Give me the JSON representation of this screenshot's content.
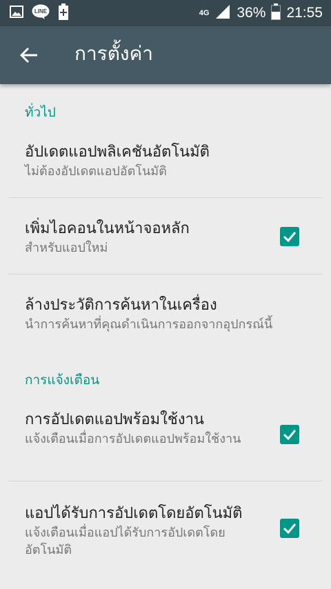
{
  "status_bar": {
    "icons_left": [
      "image-icon",
      "line-app-icon",
      "battery-saver-plus-icon"
    ],
    "network": "4G",
    "battery": "36%",
    "time": "21:55"
  },
  "app_bar": {
    "title": "การตั้งค่า",
    "back_icon": "arrow-back-icon"
  },
  "sections": {
    "general": {
      "header": "ทั่วไป",
      "items": [
        {
          "title": "อัปเดตแอปพลิเคชันอัตโนมัติ",
          "summary": "ไม่ต้องอัปเดตแอปอัตโนมัติ"
        },
        {
          "title": "เพิ่มไอคอนในหน้าจอหลัก",
          "summary": "สำหรับแอปใหม่",
          "checked": true
        },
        {
          "title": "ล้างประวัติการค้นหาในเครื่อง",
          "summary": "นำการค้นหาที่คุณดำเนินการออกจากอุปกรณ์นี้"
        }
      ]
    },
    "notifications": {
      "header": "การแจ้งเตือน",
      "items": [
        {
          "title": "การอัปเดตแอปพร้อมใช้งาน",
          "summary": "แจ้งเตือนเมื่อการอัปเดตแอปพร้อมใช้งาน",
          "checked": true
        },
        {
          "title": "แอปได้รับการอัปเดตโดยอัตโนมัติ",
          "summary": "แจ้งเตือนเมื่อแอปได้รับการอัปเดตโดยอัตโนมัติ",
          "checked": true
        }
      ]
    }
  },
  "colors": {
    "status_bar": "#37474f",
    "app_bar": "#455a64",
    "accent": "#009688",
    "background": "#ececec"
  }
}
